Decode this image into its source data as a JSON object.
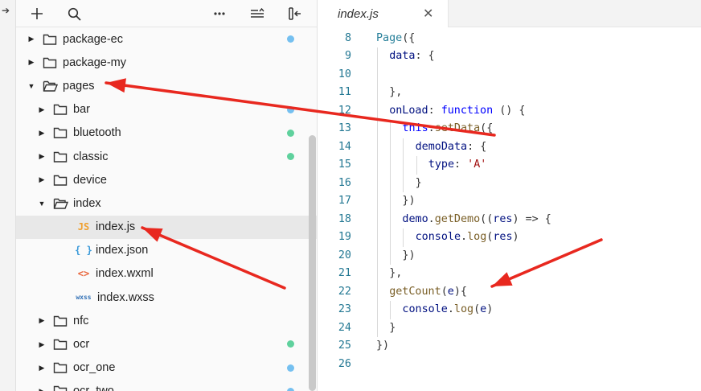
{
  "toolbar": {
    "add_icon": "plus-icon",
    "search_icon": "search-icon",
    "more_icon": "ellipsis-icon",
    "collapse_icon": "collapse-icon",
    "split_icon": "split-icon"
  },
  "tree": [
    {
      "label": "package-ec",
      "type": "folder",
      "depth": 0,
      "open": false,
      "dot": "#75c0f0"
    },
    {
      "label": "package-my",
      "type": "folder",
      "depth": 0,
      "open": false,
      "dot": ""
    },
    {
      "label": "pages",
      "type": "folder",
      "depth": 0,
      "open": true,
      "dot": ""
    },
    {
      "label": "bar",
      "type": "folder",
      "depth": 1,
      "open": false,
      "dot": "#75c0f0"
    },
    {
      "label": "bluetooth",
      "type": "folder",
      "depth": 1,
      "open": false,
      "dot": "#5fd19d"
    },
    {
      "label": "classic",
      "type": "folder",
      "depth": 1,
      "open": false,
      "dot": "#5fd19d"
    },
    {
      "label": "device",
      "type": "folder",
      "depth": 1,
      "open": false,
      "dot": ""
    },
    {
      "label": "index",
      "type": "folder",
      "depth": 1,
      "open": true,
      "dot": ""
    },
    {
      "label": "index.js",
      "type": "file",
      "icon": "JS",
      "icon_color": "#f0a030",
      "depth": 2,
      "selected": true,
      "dot": ""
    },
    {
      "label": "index.json",
      "type": "file",
      "icon": "{ }",
      "icon_color": "#3b9ad9",
      "depth": 2,
      "dot": ""
    },
    {
      "label": "index.wxml",
      "type": "file",
      "icon": "<>",
      "icon_color": "#e8643a",
      "depth": 2,
      "dot": ""
    },
    {
      "label": "index.wxss",
      "type": "file",
      "icon": "wxss",
      "icon_color": "#2f6fb5",
      "depth": 2,
      "dot": ""
    },
    {
      "label": "nfc",
      "type": "folder",
      "depth": 1,
      "open": false,
      "dot": ""
    },
    {
      "label": "ocr",
      "type": "folder",
      "depth": 1,
      "open": false,
      "dot": "#5fd19d"
    },
    {
      "label": "ocr_one",
      "type": "folder",
      "depth": 1,
      "open": false,
      "dot": "#75c0f0"
    },
    {
      "label": "ocr_two",
      "type": "folder",
      "depth": 1,
      "open": false,
      "dot": "#75c0f0"
    }
  ],
  "editor": {
    "tab_label": "index.js",
    "close_glyph": "✕",
    "lines": [
      {
        "n": "8",
        "indent": 0,
        "tokens": [
          [
            "Page",
            "#267f99"
          ],
          [
            "({",
            "#333"
          ]
        ]
      },
      {
        "n": "9",
        "indent": 1,
        "tokens": [
          [
            "data",
            "#001080"
          ],
          [
            ": {",
            "#333"
          ]
        ]
      },
      {
        "n": "10",
        "indent": 0,
        "tokens": []
      },
      {
        "n": "11",
        "indent": 1,
        "tokens": [
          [
            "},",
            "#333"
          ]
        ]
      },
      {
        "n": "12",
        "indent": 1,
        "tokens": [
          [
            "onLoad",
            "#001080"
          ],
          [
            ": ",
            "#333"
          ],
          [
            "function",
            "#0000ff"
          ],
          [
            " () {",
            "#333"
          ]
        ]
      },
      {
        "n": "13",
        "indent": 2,
        "tokens": [
          [
            "this",
            "#0000ff"
          ],
          [
            ".",
            "#333"
          ],
          [
            "setData",
            "#795e26"
          ],
          [
            "({",
            "#333"
          ]
        ]
      },
      {
        "n": "14",
        "indent": 3,
        "tokens": [
          [
            "demoData",
            "#001080"
          ],
          [
            ": {",
            "#333"
          ]
        ]
      },
      {
        "n": "15",
        "indent": 4,
        "tokens": [
          [
            "type",
            "#001080"
          ],
          [
            ": ",
            "#333"
          ],
          [
            "'A'",
            "#a31515"
          ]
        ]
      },
      {
        "n": "16",
        "indent": 3,
        "tokens": [
          [
            "}",
            "#333"
          ]
        ]
      },
      {
        "n": "17",
        "indent": 2,
        "tokens": [
          [
            "})",
            "#333"
          ]
        ]
      },
      {
        "n": "18",
        "indent": 2,
        "tokens": [
          [
            "demo",
            "#001080"
          ],
          [
            ".",
            "#333"
          ],
          [
            "getDemo",
            "#795e26"
          ],
          [
            "((",
            "#333"
          ],
          [
            "res",
            "#001080"
          ],
          [
            ") => {",
            "#333"
          ]
        ]
      },
      {
        "n": "19",
        "indent": 3,
        "tokens": [
          [
            "console",
            "#001080"
          ],
          [
            ".",
            "#333"
          ],
          [
            "log",
            "#795e26"
          ],
          [
            "(",
            "#333"
          ],
          [
            "res",
            "#001080"
          ],
          [
            ")",
            "#333"
          ]
        ]
      },
      {
        "n": "20",
        "indent": 2,
        "tokens": [
          [
            "})",
            "#333"
          ]
        ]
      },
      {
        "n": "21",
        "indent": 1,
        "tokens": [
          [
            "},",
            "#333"
          ]
        ]
      },
      {
        "n": "22",
        "indent": 1,
        "tokens": [
          [
            "getCount",
            "#795e26"
          ],
          [
            "(",
            "#333"
          ],
          [
            "e",
            "#001080"
          ],
          [
            "){",
            "#333"
          ]
        ]
      },
      {
        "n": "23",
        "indent": 2,
        "tokens": [
          [
            "console",
            "#001080"
          ],
          [
            ".",
            "#333"
          ],
          [
            "log",
            "#795e26"
          ],
          [
            "(",
            "#333"
          ],
          [
            "e",
            "#001080"
          ],
          [
            ")",
            "#333"
          ]
        ]
      },
      {
        "n": "24",
        "indent": 1,
        "tokens": [
          [
            "}",
            "#333"
          ]
        ]
      },
      {
        "n": "25",
        "indent": 0,
        "tokens": [
          [
            "})",
            "#333"
          ]
        ]
      },
      {
        "n": "26",
        "indent": 0,
        "tokens": []
      }
    ]
  },
  "colors": {
    "annotation_arrow": "#e8281f"
  }
}
